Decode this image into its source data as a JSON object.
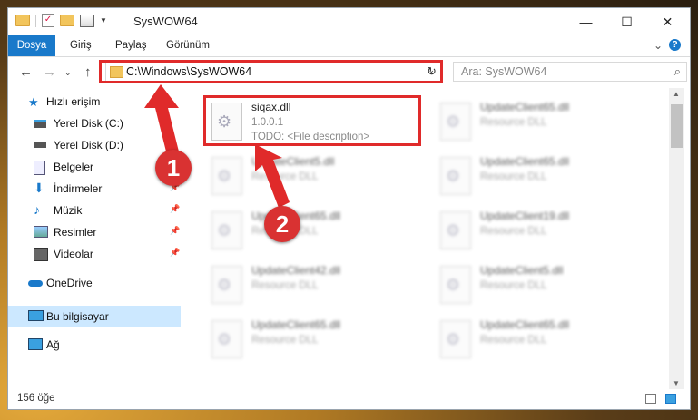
{
  "window": {
    "title": "SysWOW64"
  },
  "ribbon": {
    "file_tab": "Dosya",
    "tabs": [
      "Giriş",
      "Paylaş",
      "Görünüm"
    ]
  },
  "navigation": {
    "address": "C:\\Windows\\SysWOW64",
    "search_placeholder": "Ara: SysWOW64"
  },
  "sidebar": {
    "items": [
      {
        "label": "Hızlı erişim",
        "icon": "star-icon"
      },
      {
        "label": "Yerel Disk (C:)",
        "icon": "drive-icon",
        "pinned": true
      },
      {
        "label": "Yerel Disk (D:)",
        "icon": "drive-icon",
        "pinned": true
      },
      {
        "label": "Belgeler",
        "icon": "documents-icon",
        "pinned": true
      },
      {
        "label": "İndirmeler",
        "icon": "download-icon",
        "pinned": true
      },
      {
        "label": "Müzik",
        "icon": "music-icon",
        "pinned": true
      },
      {
        "label": "Resimler",
        "icon": "pictures-icon",
        "pinned": true
      },
      {
        "label": "Videolar",
        "icon": "videos-icon",
        "pinned": true
      },
      {
        "label": "OneDrive",
        "icon": "cloud-icon"
      },
      {
        "label": "Bu bilgisayar",
        "icon": "computer-icon",
        "selected": true
      },
      {
        "label": "Ağ",
        "icon": "network-icon"
      }
    ]
  },
  "files": [
    {
      "name": "siqax.dll",
      "line1": "1.0.0.1",
      "line2": "TODO: <File description>",
      "highlighted": true
    },
    {
      "name": "UpdateClient65.dll",
      "line1": "Resource DLL"
    },
    {
      "name": "UpdateClient5.dll",
      "line1": "Resource DLL"
    },
    {
      "name": "UpdateClient65.dll",
      "line1": "Resource DLL"
    },
    {
      "name": "UpdateClient65.dll",
      "line1": "Resource DLL"
    },
    {
      "name": "UpdateClient19.dll",
      "line1": "Resource DLL"
    },
    {
      "name": "UpdateClient42.dll",
      "line1": "Resource DLL"
    },
    {
      "name": "UpdateClient5.dll",
      "line1": "Resource DLL"
    },
    {
      "name": "UpdateClient65.dll",
      "line1": "Resource DLL"
    },
    {
      "name": "UpdateClient65.dll",
      "line1": "Resource DLL"
    }
  ],
  "status": {
    "count": "156 öğe"
  },
  "annotations": {
    "step1": "1",
    "step2": "2",
    "color": "#e02a2a"
  }
}
